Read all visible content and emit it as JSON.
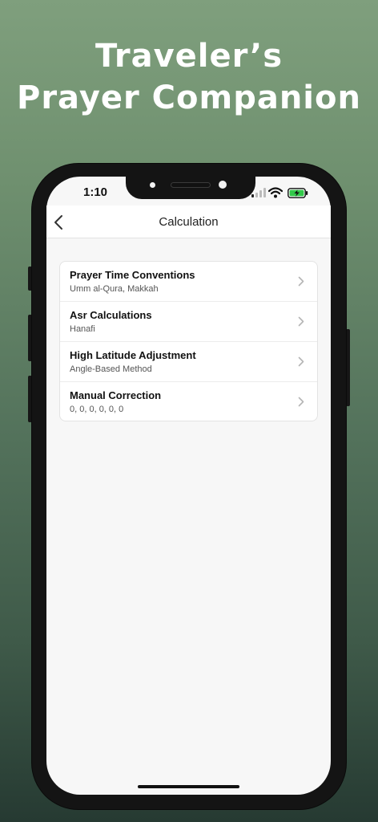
{
  "promo": {
    "headline_line1": "Traveler’s",
    "headline_line2": "Prayer Companion"
  },
  "status_bar": {
    "time": "1:10",
    "signal_icon": "cellular-signal-icon",
    "wifi_icon": "wifi-icon",
    "battery_icon": "battery-charging-icon",
    "battery_color": "#32c94a"
  },
  "nav": {
    "title": "Calculation",
    "back_icon": "chevron-left-icon"
  },
  "settings": [
    {
      "title": "Prayer Time Conventions",
      "value": "Umm al-Qura, Makkah"
    },
    {
      "title": "Asr Calculations",
      "value": "Hanafi"
    },
    {
      "title": "High Latitude Adjustment",
      "value": "Angle-Based Method"
    },
    {
      "title": "Manual Correction",
      "value": "0, 0, 0, 0, 0, 0"
    }
  ],
  "colors": {
    "background_top": "#7f9f7d",
    "background_bottom": "#263a32",
    "screen_background": "#f7f7f7"
  }
}
